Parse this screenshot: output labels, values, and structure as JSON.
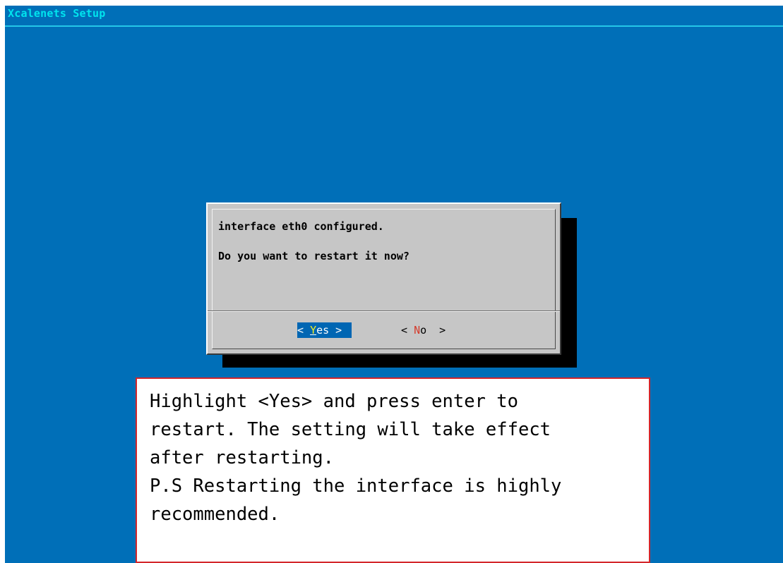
{
  "app": {
    "title": "Xcalenets Setup"
  },
  "dialog": {
    "line1": "interface eth0 configured.",
    "line2": "Do you want to restart it now?",
    "yes_button": {
      "open": "< ",
      "hotkey": "Y",
      "rest": "es",
      "close": " >",
      "selected": true
    },
    "no_button": {
      "open": "< ",
      "hotkey": "N",
      "rest": "o",
      "close": "  >",
      "selected": false
    }
  },
  "annotation": {
    "text": "Highlight <Yes> and press enter to\nrestart. The setting will take effect\nafter restarting.\nP.S Restarting the interface is highly\nrecommended."
  },
  "colors": {
    "background": "#006fb8",
    "title": "#00e4ee",
    "dialog": "#c6c6c6",
    "selected_button": "#0066b3",
    "yes_hotkey": "#f6ee22",
    "no_hotkey": "#d33b2c",
    "annotation_border": "#d3262b"
  }
}
